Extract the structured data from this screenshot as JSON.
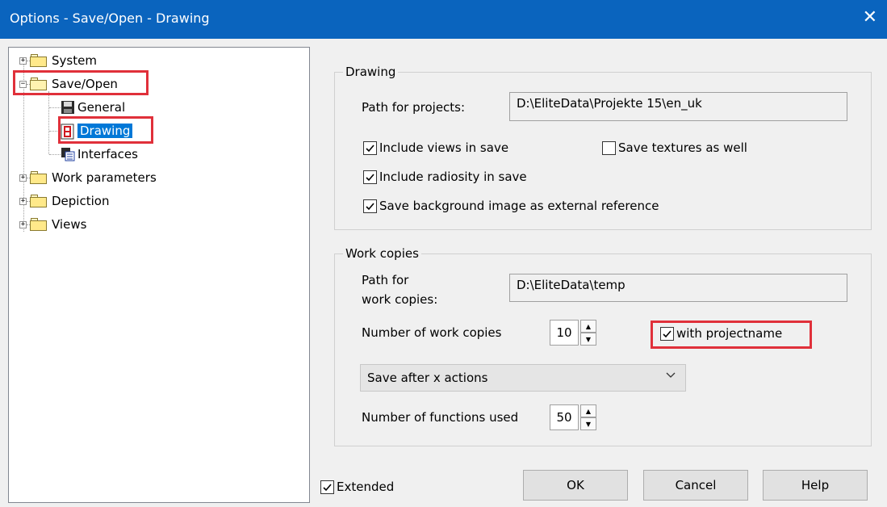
{
  "window": {
    "title": "Options - Save/Open - Drawing",
    "close_glyph": "✕"
  },
  "tree": {
    "items": [
      {
        "label": "System",
        "expander": "+"
      },
      {
        "label": "Save/Open",
        "expander": "−"
      },
      {
        "label": "General"
      },
      {
        "label": "Drawing"
      },
      {
        "label": "Interfaces"
      },
      {
        "label": "Work parameters",
        "expander": "+"
      },
      {
        "label": "Depiction",
        "expander": "+"
      },
      {
        "label": "Views",
        "expander": "+"
      }
    ]
  },
  "drawing_group": {
    "title": "Drawing",
    "path_label": "Path for projects:",
    "path_value": "D:\\EliteData\\Projekte 15\\en_uk",
    "include_views": {
      "label": "Include views in save",
      "checked": true
    },
    "save_textures": {
      "label": "Save textures as well",
      "checked": false
    },
    "include_radiosity": {
      "label": "Include radiosity in save",
      "checked": true
    },
    "save_background": {
      "label": "Save background image as external reference",
      "checked": true
    }
  },
  "work_copies_group": {
    "title": "Work copies",
    "path_label_line1": "Path for",
    "path_label_line2": "work copies:",
    "path_value": "D:\\EliteData\\temp",
    "number_label": "Number of work copies",
    "number_value": "10",
    "with_projectname": {
      "label": "with projectname",
      "checked": true
    },
    "save_mode_selected": "Save after x actions",
    "functions_label": "Number of functions used",
    "functions_value": "50"
  },
  "footer": {
    "extended": {
      "label": "Extended",
      "checked": true
    },
    "ok_label": "OK",
    "cancel_label": "Cancel",
    "help_label": "Help"
  },
  "colors": {
    "titlebar": "#0a64be",
    "selection": "#0078d7",
    "highlight_box": "#e0303a"
  }
}
